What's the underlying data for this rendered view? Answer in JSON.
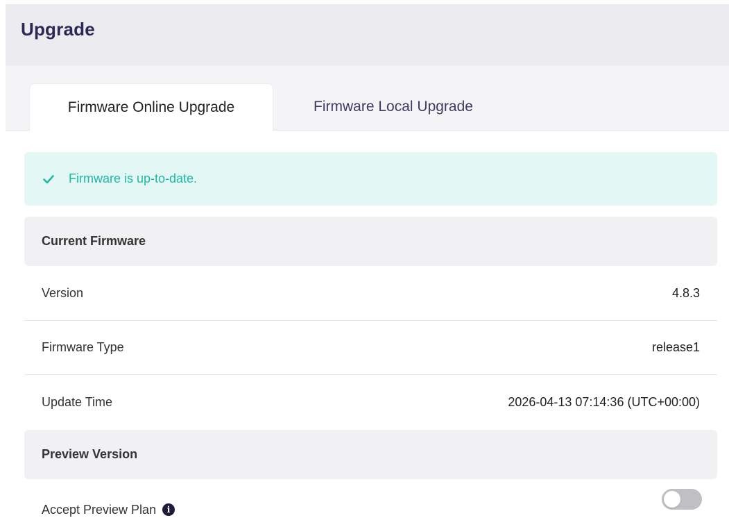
{
  "header": {
    "title": "Upgrade"
  },
  "tabs": [
    {
      "label": "Firmware Online Upgrade",
      "active": true
    },
    {
      "label": "Firmware Local Upgrade",
      "active": false
    }
  ],
  "alert": {
    "icon": "check-icon",
    "message": "Firmware is up-to-date.",
    "color": "#1fb8a7"
  },
  "current_firmware": {
    "title": "Current Firmware",
    "rows": [
      {
        "label": "Version",
        "value": "4.8.3"
      },
      {
        "label": "Firmware Type",
        "value": "release1"
      },
      {
        "label": "Update Time",
        "value": "2026-04-13 07:14:36 (UTC+00:00)"
      }
    ]
  },
  "preview_version": {
    "title": "Preview Version",
    "accept_label": "Accept Preview Plan",
    "info_icon": "info-icon",
    "toggle_on": false
  },
  "colors": {
    "title": "#2c2a55",
    "accent_success": "#1fb8a7",
    "alert_bg": "#e3f7f5",
    "section_bg": "#f1f1f4",
    "toggle_off": "#bfbfc4"
  }
}
